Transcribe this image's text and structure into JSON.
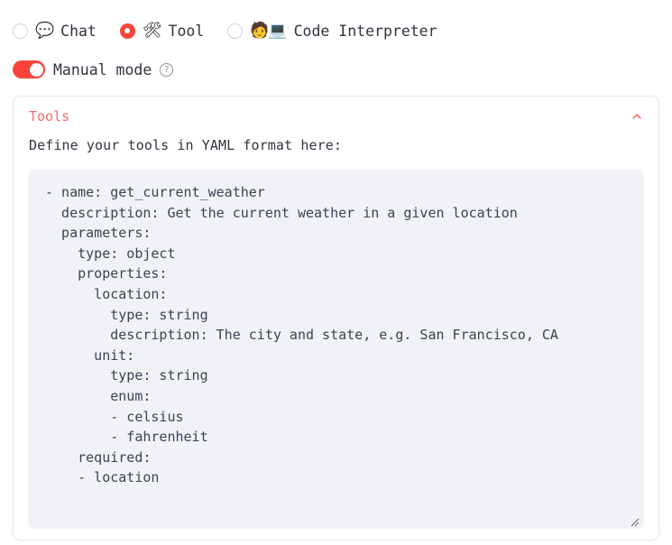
{
  "mode_selector": {
    "options": [
      {
        "label": "Chat",
        "emoji": "💬",
        "emoji_name": "speech-balloon-icon",
        "selected": false
      },
      {
        "label": "Tool",
        "emoji": "🛠",
        "emoji_name": "hammer-and-wrench-icon",
        "selected": true
      },
      {
        "label": "Code Interpreter",
        "emoji": "🧑💻",
        "emoji_name": "technologist-icon",
        "selected": false
      }
    ]
  },
  "manual_mode": {
    "label": "Manual mode",
    "enabled": true,
    "help_glyph": "?"
  },
  "tools_panel": {
    "title": "Tools",
    "expanded": true,
    "chevron_glyph": "⌃",
    "description": "Define your tools in YAML format here:",
    "yaml_value": "- name: get_current_weather\n  description: Get the current weather in a given location\n  parameters:\n    type: object\n    properties:\n      location:\n        type: string\n        description: The city and state, e.g. San Francisco, CA\n      unit:\n        type: string\n        enum:\n        - celsius\n        - fahrenheit\n    required:\n    - location",
    "yaml_placeholder": "Define your tools in YAML format here:"
  },
  "colors": {
    "accent_red": "#f9423a",
    "title_red": "#fb6a65",
    "text_dark": "#31333f",
    "code_bg": "#f0f2f6",
    "card_border": "#e4e6eb"
  }
}
